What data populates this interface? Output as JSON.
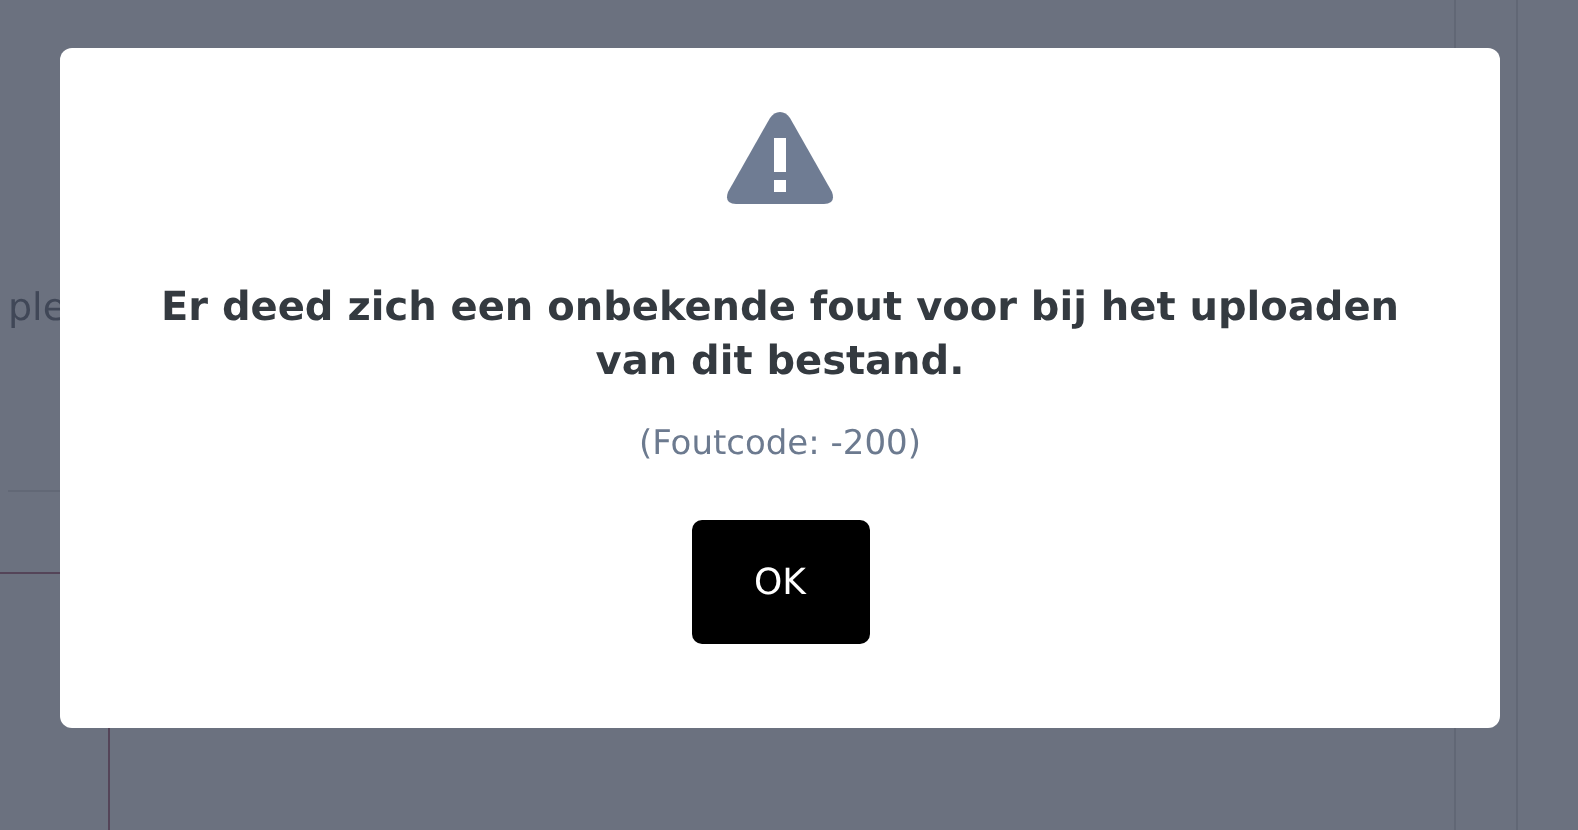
{
  "background_page": {
    "text_fragment": "ple"
  },
  "dialog": {
    "kind": "warning",
    "message": "Er deed zich een onbekende fout voor bij het uploaden van dit bestand.",
    "error_code": "(Foutcode: -200)",
    "button": "OK"
  }
}
